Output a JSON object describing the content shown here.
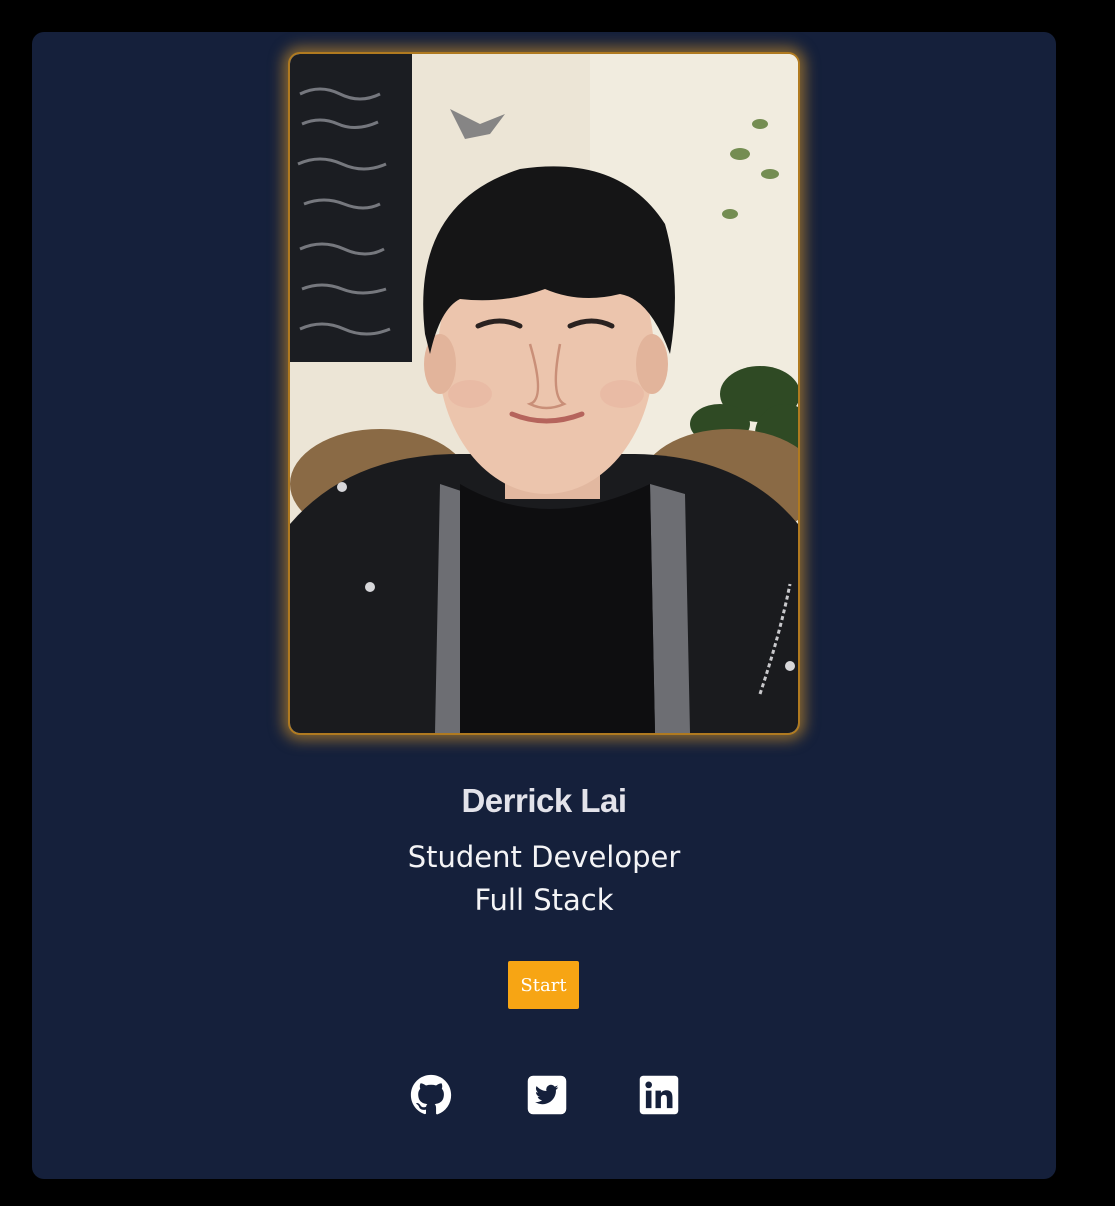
{
  "profile": {
    "name": "Derrick Lai",
    "role_line1": "Student Developer",
    "role_line2": "Full Stack",
    "photo_alt": "Derrick Lai"
  },
  "actions": {
    "start_label": "Start"
  },
  "social": [
    {
      "name": "github-icon"
    },
    {
      "name": "twitter-icon"
    },
    {
      "name": "linkedin-icon"
    }
  ],
  "colors": {
    "page_bg": "#000000",
    "card_bg": "#15203b",
    "accent": "#f7a514",
    "text": "#f4f4f6",
    "photo_glow": "#e6a028"
  }
}
